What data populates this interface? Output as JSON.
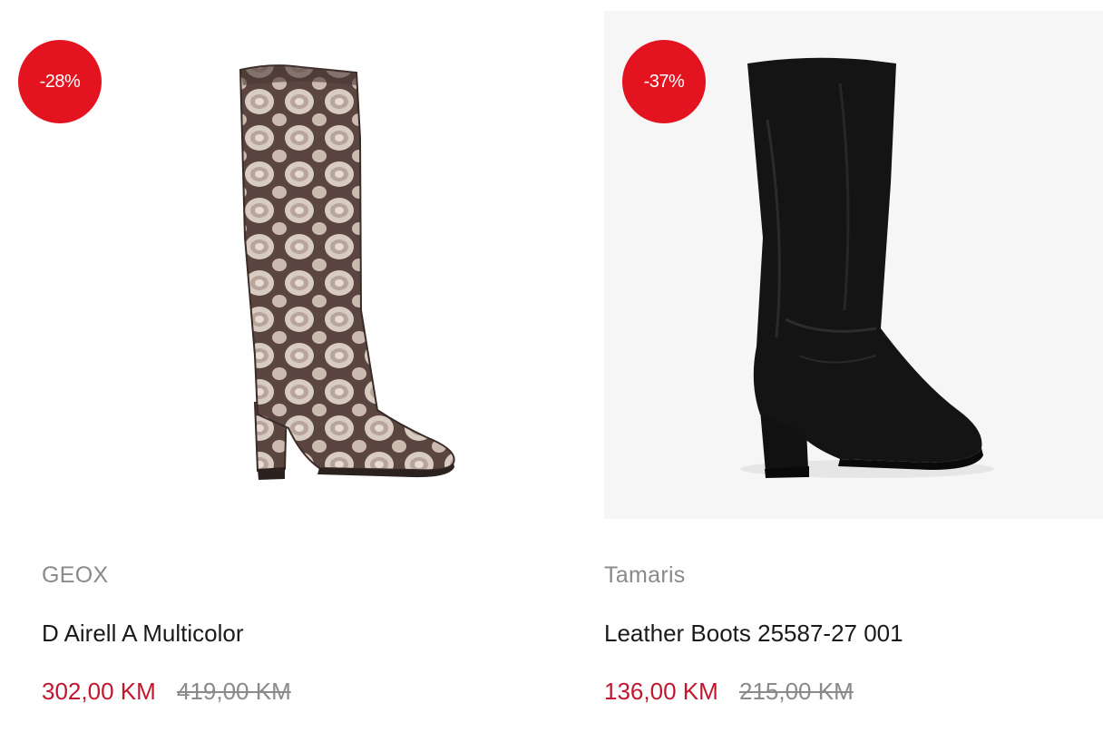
{
  "colors": {
    "badge": "#e3131f",
    "sale_price": "#c0172f",
    "old_price": "#8a8a8a",
    "brand": "#8a8a8a",
    "title": "#1a1a1a"
  },
  "products": [
    {
      "discount": "-28%",
      "image_icon": "snakeskin-knee-boot",
      "brand": "GEOX",
      "name": "D Airell A Multicolor",
      "price": "302,00 KM",
      "old_price": "419,00 KM"
    },
    {
      "discount": "-37%",
      "image_icon": "black-suede-knee-boot",
      "brand": "Tamaris",
      "name": "Leather Boots 25587-27 001",
      "price": "136,00 KM",
      "old_price": "215,00 KM"
    }
  ]
}
